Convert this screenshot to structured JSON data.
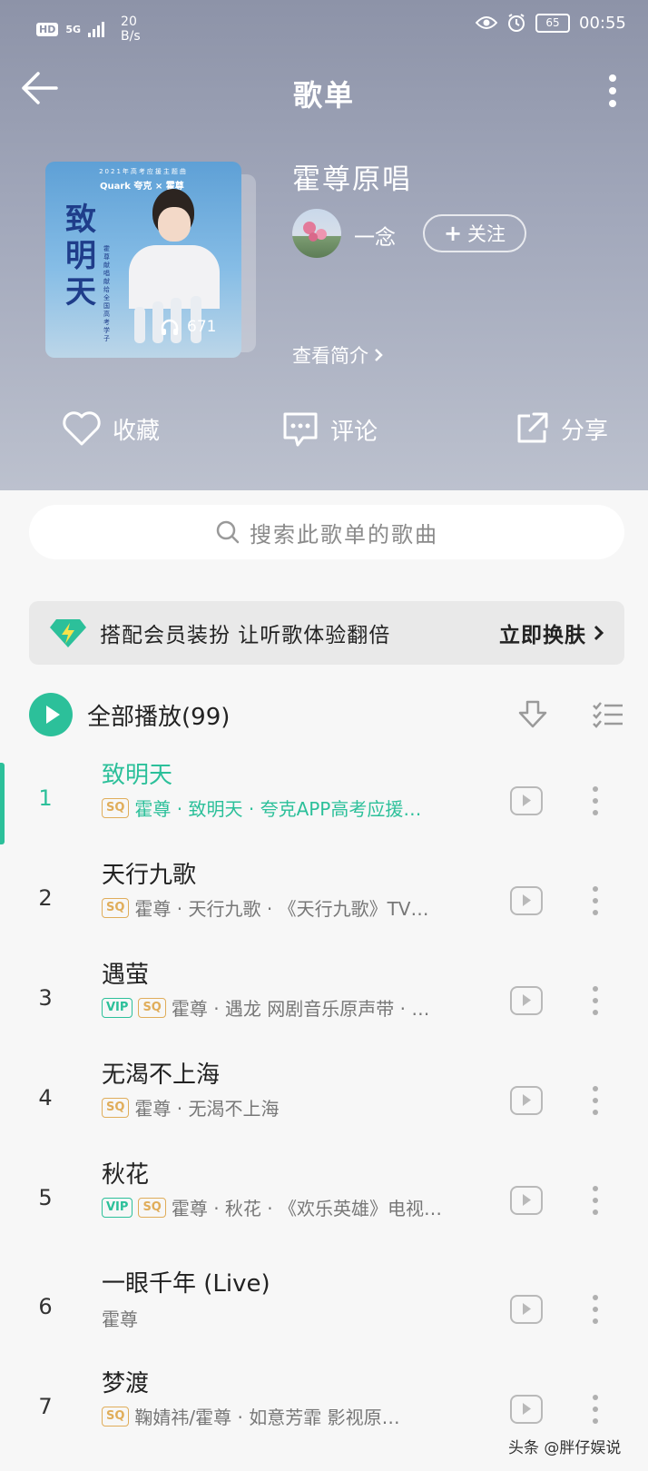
{
  "status_bar": {
    "network": "HD",
    "signal": "5G",
    "speed_top": "20",
    "speed_bottom": "B/s",
    "battery": "65",
    "time": "00:55"
  },
  "header": {
    "title": "歌单"
  },
  "playlist": {
    "name": "霍尊原唱",
    "creator": "一念",
    "follow_label": "关注",
    "intro_label": "查看简介",
    "play_count": "671",
    "cover": {
      "tagline": "2021年高考应援主题曲",
      "brand": "Quark 夸克 × 霍尊",
      "calligraphy": "致明天",
      "caption": "霍尊献唱 献给全国高考学子"
    }
  },
  "actions": {
    "collect": "收藏",
    "comment": "评论",
    "share": "分享"
  },
  "search": {
    "placeholder": "搜索此歌单的歌曲"
  },
  "banner": {
    "text": "搭配会员装扮  让听歌体验翻倍",
    "cta": "立即换肤"
  },
  "play_all": {
    "label": "全部播放",
    "count": "(99)"
  },
  "songs": [
    {
      "num": "1",
      "title": "致明天",
      "vip": "",
      "sq": "SQ",
      "sub": "霍尊 · 致明天 · 夸克APP高考应援…"
    },
    {
      "num": "2",
      "title": "天行九歌",
      "vip": "",
      "sq": "SQ",
      "sub": "霍尊 · 天行九歌 · 《天行九歌》TV…"
    },
    {
      "num": "3",
      "title": "遇萤",
      "vip": "VIP",
      "sq": "SQ",
      "sub": "霍尊 · 遇龙 网剧音乐原声带 · …"
    },
    {
      "num": "4",
      "title": "无渴不上海",
      "vip": "",
      "sq": "SQ",
      "sub": "霍尊 · 无渴不上海"
    },
    {
      "num": "5",
      "title": "秋花",
      "vip": "VIP",
      "sq": "SQ",
      "sub": "霍尊 · 秋花 · 《欢乐英雄》电视…"
    },
    {
      "num": "6",
      "title": "一眼千年 (Live)",
      "vip": "",
      "sq": "",
      "sub": "霍尊"
    },
    {
      "num": "7",
      "title": "梦渡",
      "vip": "",
      "sq": "SQ",
      "sub": "鞠婧祎/霍尊 · 如意芳霏 影视原…"
    }
  ],
  "colors": {
    "accent": "#2cc09a",
    "sq": "#e0ad5a",
    "header_bg": "#9aa0b4"
  },
  "watermark": "头条 @胖仔娱说"
}
